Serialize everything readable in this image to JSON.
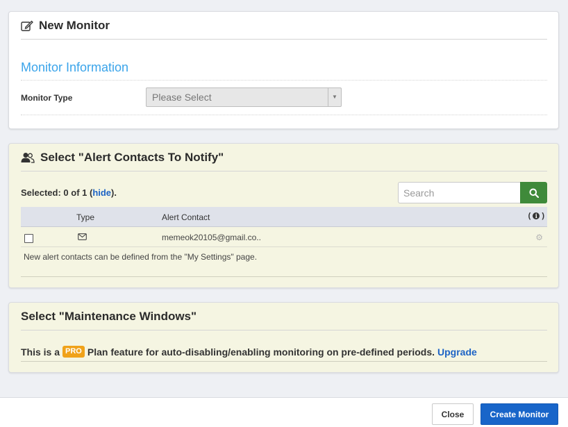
{
  "new_monitor": {
    "title": "New Monitor",
    "icon": "edit-icon",
    "section_title": "Monitor Information",
    "monitor_type_label": "Monitor Type",
    "monitor_type_value": "Please Select"
  },
  "alert_contacts": {
    "title": "Select \"Alert Contacts To Notify\"",
    "icon": "users-icon",
    "selected_prefix": "Selected: 0 of 1 (",
    "hide_link": "hide",
    "selected_suffix": ").",
    "search_placeholder": "Search",
    "columns": {
      "type": "Type",
      "contact": "Alert Contact",
      "info": "( )"
    },
    "rows": [
      {
        "type_icon": "envelope-icon",
        "contact": "memeok20105@gmail.co..",
        "checked": false
      }
    ],
    "note": "New alert contacts can be defined from the \"My Settings\" page."
  },
  "maintenance": {
    "title": "Select \"Maintenance Windows\"",
    "text_before": "This is a",
    "badge": "PRO",
    "text_after": "Plan feature for auto-disabling/enabling monitoring on pre-defined periods.",
    "upgrade_link": "Upgrade"
  },
  "footer": {
    "close_label": "Close",
    "create_label": "Create Monitor"
  },
  "colors": {
    "accent_blue": "#3aa4ea",
    "link_blue": "#1d63c5",
    "search_green": "#3f8a3a",
    "pro_orange": "#f0a21a",
    "create_blue": "#1865c9"
  }
}
